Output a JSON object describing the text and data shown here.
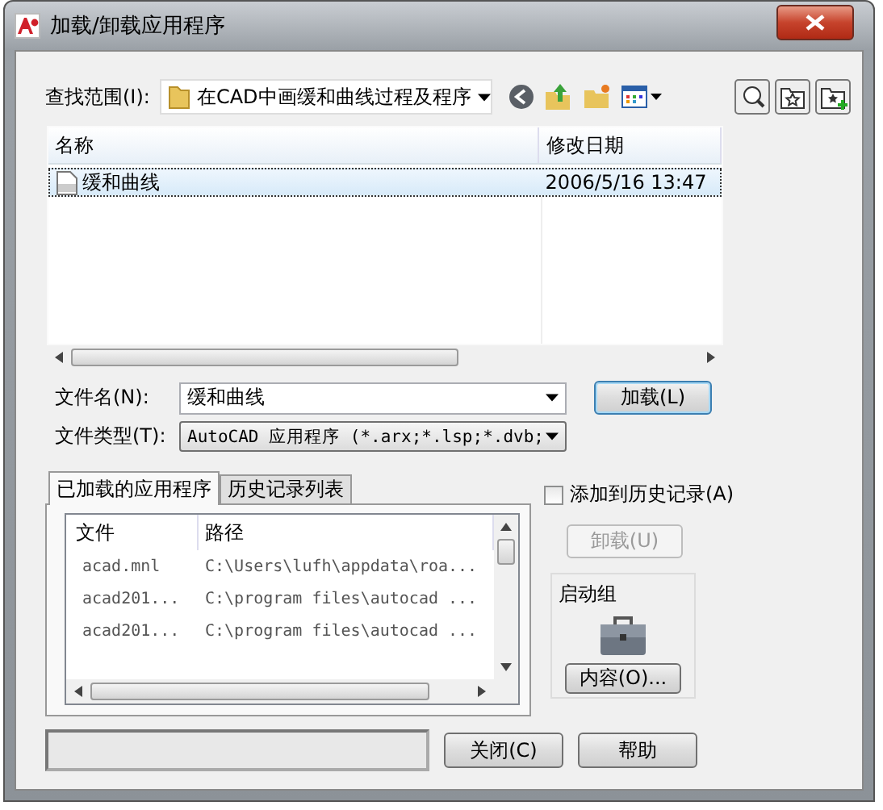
{
  "window": {
    "title": "加载/卸载应用程序"
  },
  "look_in": {
    "label": "查找范围(I):",
    "value": "在CAD中画缓和曲线过程及程序"
  },
  "file_list": {
    "columns": [
      "名称",
      "修改日期"
    ],
    "rows": [
      {
        "name": "缓和曲线",
        "date": "2006/5/16 13:47",
        "selected": true
      }
    ]
  },
  "file_name": {
    "label": "文件名(N):",
    "value": "缓和曲线"
  },
  "file_type": {
    "label": "文件类型(T):",
    "value": "AutoCAD 应用程序 (*.arx;*.lsp;*.dvb;"
  },
  "load_button": "加载(L)",
  "tabs": [
    {
      "label": "已加载的应用程序",
      "selected": true
    },
    {
      "label": "历史记录列表",
      "selected": false
    }
  ],
  "loaded_apps": {
    "columns": [
      "文件",
      "路径"
    ],
    "rows": [
      {
        "file": "acad.mnl",
        "path": "C:\\Users\\lufh\\appdata\\roa..."
      },
      {
        "file": "acad201...",
        "path": "C:\\program files\\autocad ..."
      },
      {
        "file": "acad201...",
        "path": "C:\\program files\\autocad ..."
      }
    ]
  },
  "add_to_history": {
    "label": "添加到历史记录(A)",
    "checked": false
  },
  "unload_button": {
    "label": "卸载(U)",
    "disabled": true
  },
  "startup_suite": {
    "title": "启动组",
    "button": "内容(O)..."
  },
  "buttons": [
    "关闭(C)",
    "帮助"
  ]
}
